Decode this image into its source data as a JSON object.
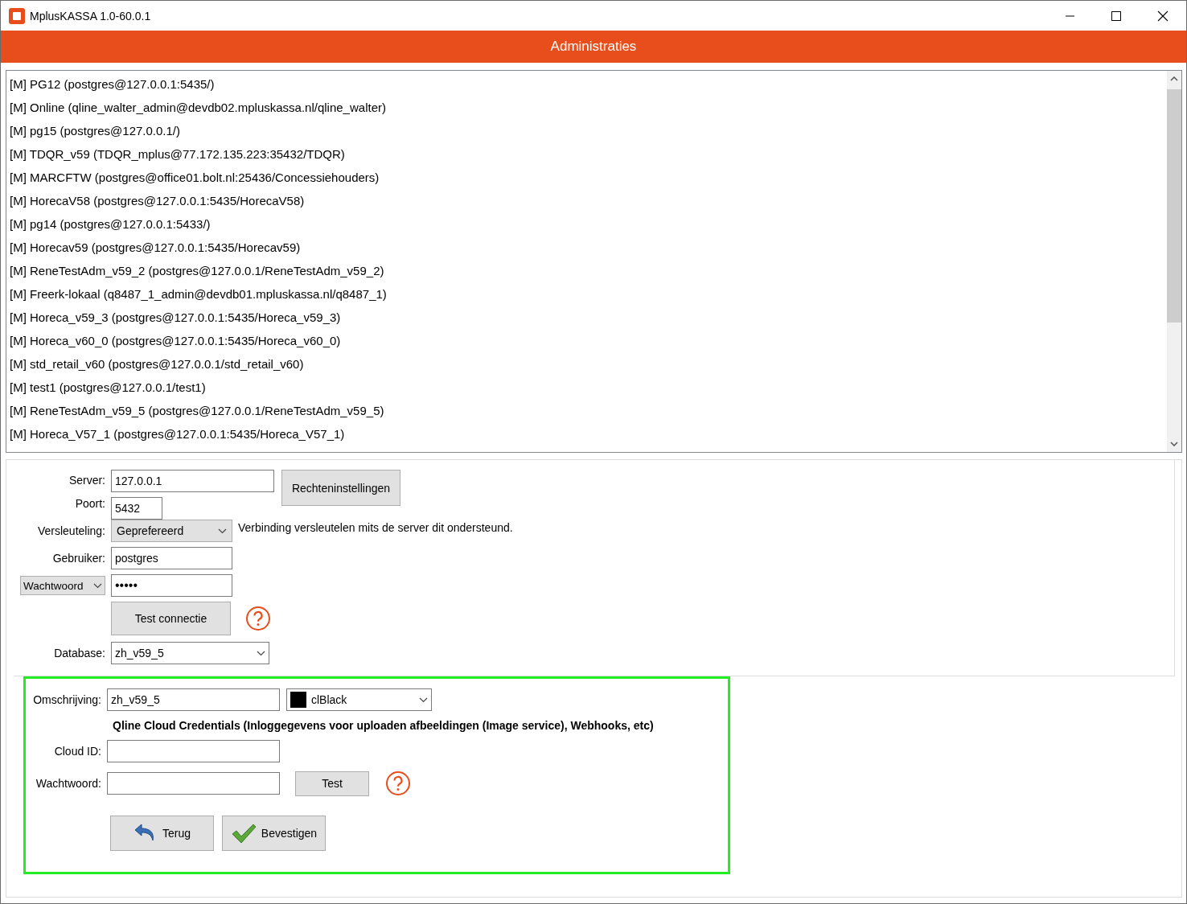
{
  "window": {
    "title": "MplusKASSA 1.0-60.0.1"
  },
  "header": {
    "title": "Administraties"
  },
  "administrations": [
    "[M] PG12 (postgres@127.0.0.1:5435/)",
    "[M] Online (qline_walter_admin@devdb02.mpluskassa.nl/qline_walter)",
    "[M] pg15 (postgres@127.0.0.1/)",
    "[M] TDQR_v59 (TDQR_mplus@77.172.135.223:35432/TDQR)",
    "[M] MARCFTW (postgres@office01.bolt.nl:25436/Concessiehouders)",
    "[M] HorecaV58 (postgres@127.0.0.1:5435/HorecaV58)",
    "[M] pg14 (postgres@127.0.0.1:5433/)",
    "[M] Horecav59 (postgres@127.0.0.1:5435/Horecav59)",
    "[M] ReneTestAdm_v59_2 (postgres@127.0.0.1/ReneTestAdm_v59_2)",
    "[M] Freerk-lokaal (q8487_1_admin@devdb01.mpluskassa.nl/q8487_1)",
    "[M] Horeca_v59_3 (postgres@127.0.0.1:5435/Horeca_v59_3)",
    "[M] Horeca_v60_0 (postgres@127.0.0.1:5435/Horeca_v60_0)",
    "[M] std_retail_v60 (postgres@127.0.0.1/std_retail_v60)",
    "[M] test1 (postgres@127.0.0.1/test1)",
    "[M] ReneTestAdm_v59_5 (postgres@127.0.0.1/ReneTestAdm_v59_5)",
    "[M] Horeca_V57_1 (postgres@127.0.0.1:5435/Horeca_V57_1)"
  ],
  "connection": {
    "server": {
      "label": "Server:",
      "value": "127.0.0.1"
    },
    "rights_button": "Rechteninstellingen",
    "port": {
      "label": "Poort:",
      "value": "5432"
    },
    "encryption": {
      "label": "Versleuteling:",
      "value": "Geprefereerd",
      "note": "Verbinding versleutelen mits de server dit ondersteund."
    },
    "user": {
      "label": "Gebruiker:",
      "value": "postgres"
    },
    "password": {
      "mode": "Wachtwoord",
      "value": "•••••"
    },
    "test_button": "Test connectie",
    "database": {
      "label": "Database:",
      "value": "zh_v59_5"
    }
  },
  "details": {
    "description": {
      "label": "Omschrijving:",
      "value": "zh_v59_5"
    },
    "color": {
      "color": "#000000",
      "value": "clBlack"
    },
    "cloud_heading": "Qline Cloud Credentials (Inloggegevens voor uploaden afbeeldingen (Image service), Webhooks, etc)",
    "cloud_id": {
      "label": "Cloud ID:"
    },
    "cloud_password": {
      "label": "Wachtwoord:"
    },
    "test_button": "Test",
    "buttons": [
      {
        "label": "Terug",
        "kind": "back"
      },
      {
        "label": "Bevestigen",
        "kind": "confirm"
      }
    ]
  }
}
